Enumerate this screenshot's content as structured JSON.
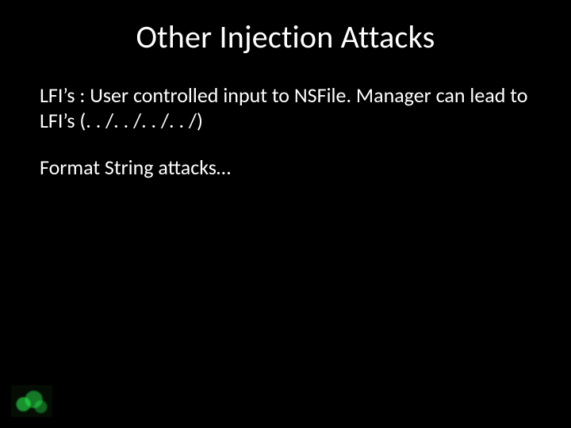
{
  "title": "Other Injection Attacks",
  "paragraphs": {
    "p1": "LFI’s : User controlled input  to NSFile. Manager can lead to LFI’s (. . /. . /. . /. . /)",
    "p2": "Format String attacks…"
  }
}
